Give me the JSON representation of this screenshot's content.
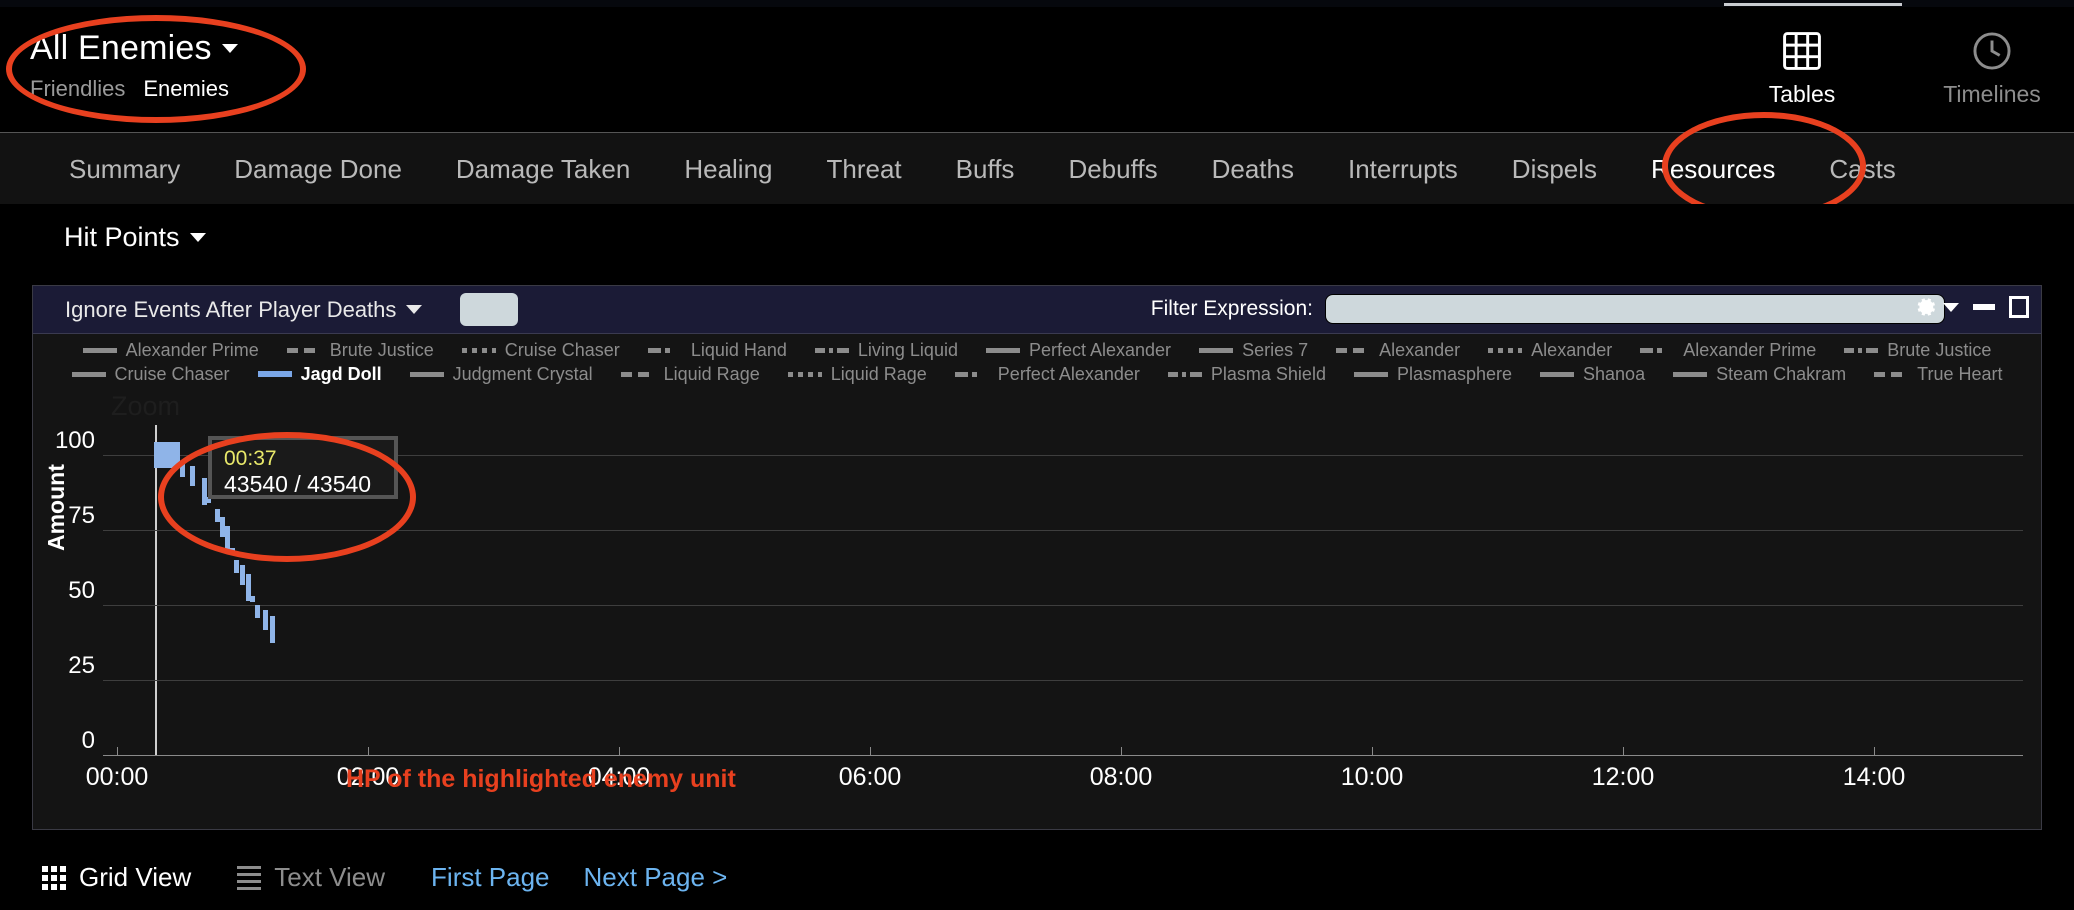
{
  "header": {
    "enemy_selector_label": "All Enemies",
    "side_tabs": [
      {
        "label": "Friendlies",
        "selected": false
      },
      {
        "label": "Enemies",
        "selected": true
      }
    ],
    "view_modes": [
      {
        "label": "Tables",
        "icon": "grid-icon",
        "active": true
      },
      {
        "label": "Timelines",
        "icon": "clock-icon",
        "active": false
      }
    ]
  },
  "nav_tabs": [
    {
      "label": "Summary",
      "selected": false
    },
    {
      "label": "Damage Done",
      "selected": false
    },
    {
      "label": "Damage Taken",
      "selected": false
    },
    {
      "label": "Healing",
      "selected": false
    },
    {
      "label": "Threat",
      "selected": false
    },
    {
      "label": "Buffs",
      "selected": false
    },
    {
      "label": "Debuffs",
      "selected": false
    },
    {
      "label": "Deaths",
      "selected": false
    },
    {
      "label": "Interrupts",
      "selected": false
    },
    {
      "label": "Dispels",
      "selected": false
    },
    {
      "label": "Resources",
      "selected": true
    },
    {
      "label": "Casts",
      "selected": false
    }
  ],
  "resource_selector": {
    "label": "Hit Points"
  },
  "panel_bar": {
    "ignore_dropdown_label": "Ignore Events After Player Deaths",
    "filter_label": "Filter Expression:",
    "filter_value": "",
    "filter_placeholder": "",
    "gear_icon": "gear-icon",
    "minimize_icon": "minimize-icon",
    "maximize_icon": "maximize-icon"
  },
  "legend": {
    "row1": [
      {
        "label": "Alexander Prime",
        "style": "solid",
        "highlight": false
      },
      {
        "label": "Brute Justice",
        "style": "dash",
        "highlight": false
      },
      {
        "label": "Cruise Chaser",
        "style": "dot",
        "highlight": false
      },
      {
        "label": "Liquid Hand",
        "style": "dashdot",
        "highlight": false
      },
      {
        "label": "Living Liquid",
        "style": "dashdotdot",
        "highlight": false
      },
      {
        "label": "Perfect Alexander",
        "style": "solid",
        "highlight": false
      },
      {
        "label": "Series 7",
        "style": "solid",
        "highlight": false
      },
      {
        "label": "Alexander",
        "style": "dash",
        "highlight": false
      },
      {
        "label": "Alexander",
        "style": "dot",
        "highlight": false
      },
      {
        "label": "Alexander Prime",
        "style": "dashdot",
        "highlight": false
      },
      {
        "label": "Brute Justice",
        "style": "dashdotdot",
        "highlight": false
      }
    ],
    "row2": [
      {
        "label": "Cruise Chaser",
        "style": "solid",
        "highlight": false
      },
      {
        "label": "Jagd Doll",
        "style": "solid",
        "highlight": true
      },
      {
        "label": "Judgment Crystal",
        "style": "solid",
        "highlight": false
      },
      {
        "label": "Liquid Rage",
        "style": "dash",
        "highlight": false
      },
      {
        "label": "Liquid Rage",
        "style": "dot",
        "highlight": false
      },
      {
        "label": "Perfect Alexander",
        "style": "dashdot",
        "highlight": false
      },
      {
        "label": "Plasma Shield",
        "style": "dashdotdot",
        "highlight": false
      },
      {
        "label": "Plasmasphere",
        "style": "solid",
        "highlight": false
      },
      {
        "label": "Shanoa",
        "style": "solid",
        "highlight": false
      },
      {
        "label": "Steam Chakram",
        "style": "solid",
        "highlight": false
      },
      {
        "label": "True Heart",
        "style": "dash",
        "highlight": false
      }
    ]
  },
  "chart_data": {
    "type": "scatter",
    "title": "",
    "zoom_watermark": "Zoom",
    "xlabel": "",
    "ylabel": "Amount",
    "ylim": [
      0,
      110
    ],
    "yticks": [
      0,
      25,
      50,
      75,
      100
    ],
    "ytick_labels": [
      "0",
      "25",
      "50",
      "75",
      "100"
    ],
    "xlim": [
      "00:00",
      "15:00"
    ],
    "xticks": [
      "00:00",
      "02:00",
      "04:00",
      "06:00",
      "08:00",
      "10:00",
      "12:00",
      "14:00"
    ],
    "grid": true,
    "legend_position": "top",
    "series_name": "Jagd Doll",
    "series_color": "#8fb4e8",
    "cursor_time": "00:37",
    "points": [
      {
        "t": 0.4,
        "v": 100
      },
      {
        "t": 0.52,
        "v": 95
      },
      {
        "t": 0.6,
        "v": 93
      },
      {
        "t": 0.7,
        "v": 88
      },
      {
        "t": 0.73,
        "v": 85
      },
      {
        "t": 0.8,
        "v": 80
      },
      {
        "t": 0.84,
        "v": 76
      },
      {
        "t": 0.88,
        "v": 72
      },
      {
        "t": 0.92,
        "v": 68
      },
      {
        "t": 0.95,
        "v": 63
      },
      {
        "t": 1.0,
        "v": 60
      },
      {
        "t": 1.05,
        "v": 56
      },
      {
        "t": 1.08,
        "v": 52
      },
      {
        "t": 1.12,
        "v": 48
      },
      {
        "t": 1.18,
        "v": 45
      },
      {
        "t": 1.24,
        "v": 42
      }
    ]
  },
  "tooltip": {
    "time": "00:37",
    "value": "43540 / 43540"
  },
  "annotation": {
    "text": "HP of the highlighted enemy unit",
    "color": "#e8401f"
  },
  "footer": {
    "grid_view_label": "Grid View",
    "text_view_label": "Text View",
    "first_page_label": "First Page",
    "next_page_label": "Next Page >"
  }
}
